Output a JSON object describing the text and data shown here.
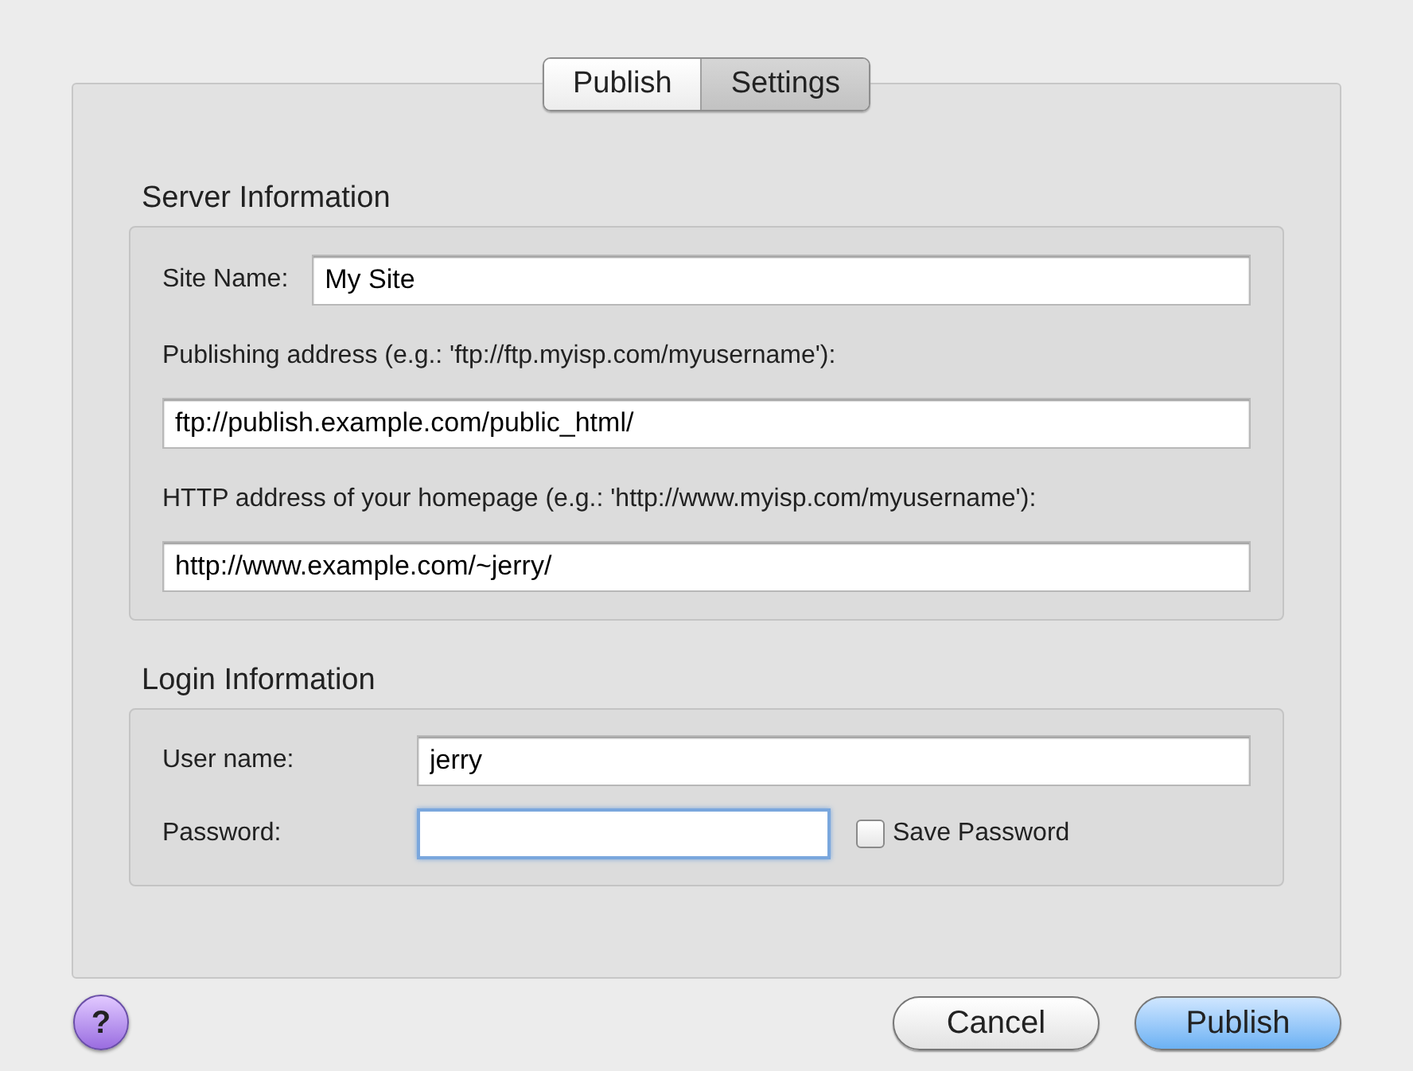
{
  "tabs": [
    {
      "label": "Publish",
      "selected": false
    },
    {
      "label": "Settings",
      "selected": true
    }
  ],
  "server_information": {
    "title": "Server Information",
    "site_name": {
      "label": "Site Name:",
      "value": "My Site"
    },
    "publishing_address": {
      "label": "Publishing address (e.g.: 'ftp://ftp.myisp.com/myusername'):",
      "value": "ftp://publish.example.com/public_html/"
    },
    "http_address": {
      "label": "HTTP address of your homepage (e.g.: 'http://www.myisp.com/myusername'):",
      "value": "http://www.example.com/~jerry/"
    }
  },
  "login_information": {
    "title": "Login Information",
    "user_name": {
      "label": "User name:",
      "value": "jerry"
    },
    "password": {
      "label": "Password:",
      "focused": true
    },
    "save_password": {
      "label": "Save Password",
      "checked": false
    }
  },
  "help": {
    "label": "?"
  },
  "buttons": [
    {
      "label": "Cancel",
      "default": false
    },
    {
      "label": "Publish",
      "default": true
    }
  ]
}
